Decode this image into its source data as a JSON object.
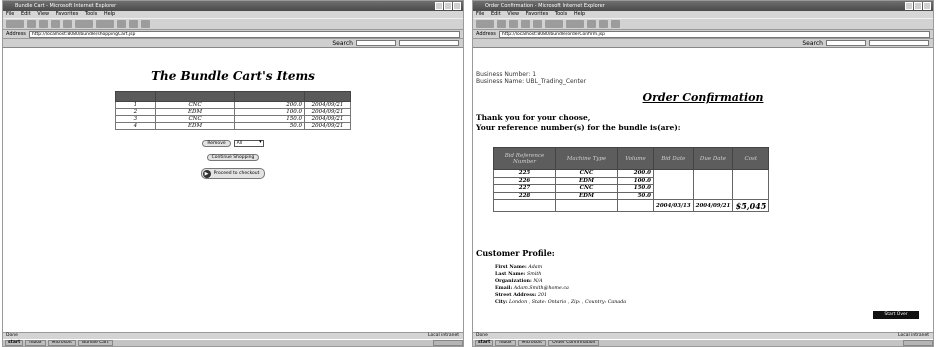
{
  "left": {
    "window_title": "Bundle Cart - Microsoft Internet Explorer",
    "menu": [
      "File",
      "Edit",
      "View",
      "Favorites",
      "Tools",
      "Help"
    ],
    "address_label": "Address",
    "address": "http://localhost:8080/bundle/shoppingCart.jsp",
    "search_label": "Search",
    "page_title": "The Bundle Cart's Items",
    "table_headers": [
      "",
      "",
      "",
      ""
    ],
    "rows": [
      {
        "no": "1",
        "machine": "CNC",
        "value": "200.0",
        "date": "2004/09/21"
      },
      {
        "no": "2",
        "machine": "EDM",
        "value": "100.0",
        "date": "2004/09/21"
      },
      {
        "no": "3",
        "machine": "CNC",
        "value": "150.0",
        "date": "2004/09/21"
      },
      {
        "no": "4",
        "machine": "EDM",
        "value": "50.0",
        "date": "2004/09/21"
      }
    ],
    "remove_label": "Remove",
    "select_value": "All",
    "continue_label": "Continue Shopping",
    "checkout_label": "Proceed to checkout",
    "status": "Done",
    "zone": "Local intranet",
    "taskbar": [
      "start",
      "Inbox",
      "Microsoft",
      "Bundle Cart"
    ]
  },
  "right": {
    "window_title": "Order Confirmation - Microsoft Internet Explorer",
    "menu": [
      "File",
      "Edit",
      "View",
      "Favorites",
      "Tools",
      "Help"
    ],
    "address_label": "Address",
    "address": "http://localhost:8080/bundle/orderConfirm.jsp",
    "search_label": "Search",
    "business_number": "Business Number: 1",
    "business_name": "Business Name: UBL_Trading_Center",
    "page_title": "Order Confirmation",
    "thanks_line1": "Thank you for your choose,",
    "thanks_line2": "Your reference number(s) for the bundle is(are):",
    "table_headers": [
      "Bid Reference Number",
      "Machine Type",
      "Volume",
      "Bid Date",
      "Due Date",
      "Cost"
    ],
    "rows": [
      {
        "ref": "225",
        "machine": "CNC",
        "volume": "200.0"
      },
      {
        "ref": "226",
        "machine": "EDM",
        "volume": "100.0"
      },
      {
        "ref": "227",
        "machine": "CNC",
        "volume": "150.0"
      },
      {
        "ref": "228",
        "machine": "EDM",
        "volume": "50.0"
      }
    ],
    "summary": {
      "bid_date": "2004/03/13",
      "due_date": "2004/09/21",
      "cost": "$5,045"
    },
    "profile_heading": "Customer Profile:",
    "profile": [
      {
        "label": "First Name:",
        "value": "Adam"
      },
      {
        "label": "Last Name:",
        "value": "Smith"
      },
      {
        "label": "Organization:",
        "value": "N/A"
      },
      {
        "label": "Email:",
        "value": "Adam.Smith@home.ca"
      },
      {
        "label": "Street Address:",
        "value": "201"
      },
      {
        "label": "City:",
        "value": "London , State: Ontario , Zip: , Country: Canada"
      }
    ],
    "start_over": "Start Over",
    "status": "Done",
    "zone": "Local intranet",
    "taskbar": [
      "start",
      "Inbox",
      "Microsoft",
      "Order Confirmation"
    ]
  }
}
